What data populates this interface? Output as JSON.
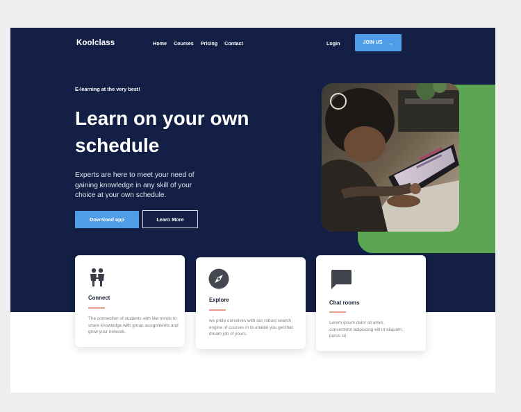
{
  "brand": {
    "name": "Koolclass"
  },
  "nav": {
    "items": [
      "Home",
      "Courses",
      "Pricing",
      "Contact"
    ]
  },
  "header": {
    "login_label": "Login",
    "join_label": "JOIN US"
  },
  "hero": {
    "tagline": "E-learning at the very best!",
    "headline": "Learn on your own schedule",
    "description": "Experts are here to meet your need of gaining knowledge in any skill of your choice at your own schedule.",
    "primary_button": "Download app",
    "secondary_button": "Learn More"
  },
  "features": [
    {
      "title": "Connect",
      "icon": "people-icon",
      "text": "The connection of students with like minds to share knowledge with group assignments and grow your network."
    },
    {
      "title": "Explore",
      "icon": "compass-icon",
      "text": "we pride ourselves with our robust search engine of courses in  to enable you get that dream job of yours."
    },
    {
      "title": "Chat rooms",
      "icon": "chat-icon",
      "text": "Lorem ipsum dolor sit amet, consectetur adipiscing elit ut aliquam, purus sit"
    }
  ],
  "colors": {
    "navy": "#131f44",
    "accent_blue": "#4e9de6",
    "accent_green": "#5ba553",
    "underline": "#e79b8e"
  }
}
